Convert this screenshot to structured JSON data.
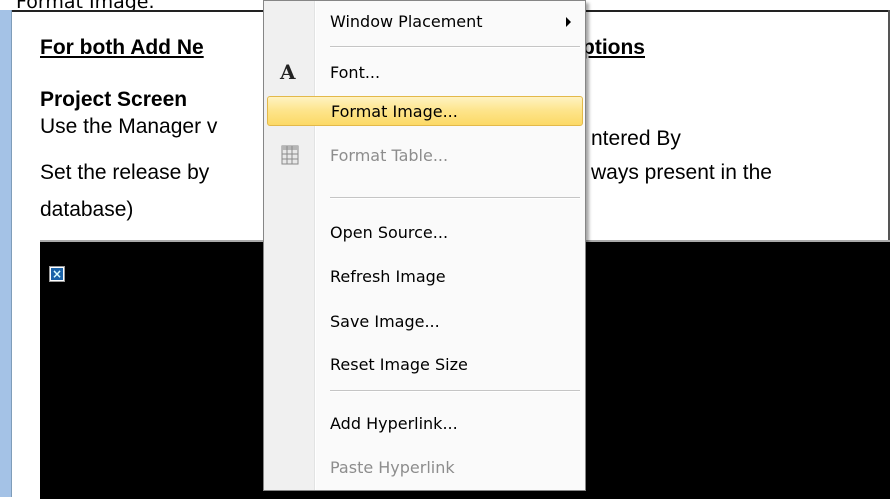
{
  "caption": "Format Image.",
  "document": {
    "heading": "For both Add Ne",
    "heading_tail": "ptions",
    "subheading": "Project Screen",
    "line1_left": "Use the Manager v",
    "line1_right": "ntered By",
    "line2_left": "Set the release by",
    "line2_right": "ways present in  the",
    "line3": "database)"
  },
  "image_block": {
    "broken_icon": "broken-image-icon",
    "glyph": "×"
  },
  "context_menu": {
    "items": [
      {
        "label": "Window Placement",
        "submenu": true
      },
      {
        "label": "Font...",
        "icon": "font-icon",
        "icon_glyph": "A"
      },
      {
        "label": "Format Image...",
        "highlighted": true
      },
      {
        "label": "Format Table...",
        "disabled": true,
        "icon": "table-icon"
      },
      {
        "label": "Open Source..."
      },
      {
        "label": "Refresh Image"
      },
      {
        "label": "Save Image..."
      },
      {
        "label": "Reset Image Size"
      },
      {
        "label": "Add Hyperlink..."
      },
      {
        "label": "Paste Hyperlink",
        "disabled": true
      }
    ]
  },
  "colors": {
    "highlight": "#fde48a",
    "left_bar": "#a4c2e6",
    "disabled_text": "#8d8d8d"
  }
}
